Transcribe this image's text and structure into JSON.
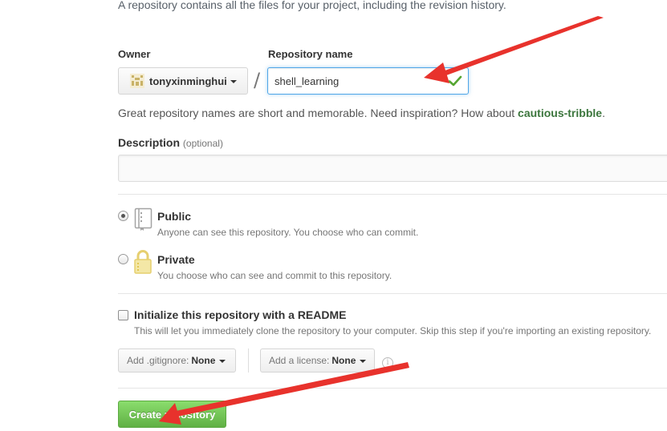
{
  "intro_text": "A repository contains all the files for your project, including the revision history.",
  "owner": {
    "label": "Owner",
    "value": "tonyxinminghui"
  },
  "separator": "/",
  "repo_name": {
    "label": "Repository name",
    "value": "shell_learning"
  },
  "hint": {
    "text": "Great repository names are short and memorable. Need inspiration? How about ",
    "suggestion": "cautious-tribble",
    "end": "."
  },
  "description": {
    "label": "Description",
    "optional": "(optional)",
    "value": ""
  },
  "visibility": {
    "public": {
      "title": "Public",
      "note": "Anyone can see this repository. You choose who can commit.",
      "checked": true
    },
    "private": {
      "title": "Private",
      "note": "You choose who can see and commit to this repository.",
      "checked": false
    }
  },
  "readme": {
    "title": "Initialize this repository with a README",
    "note": "This will let you immediately clone the repository to your computer. Skip this step if you're importing an existing repository.",
    "checked": false
  },
  "gitignore": {
    "label": "Add .gitignore:",
    "value": "None"
  },
  "license": {
    "label": "Add a license:",
    "value": "None"
  },
  "info_glyph": "i",
  "create_button": "Create repository",
  "colors": {
    "accent_green": "#60b044",
    "focus_blue": "#51a7e8",
    "annotation_red": "#e8322c",
    "success_check": "#55a532"
  }
}
